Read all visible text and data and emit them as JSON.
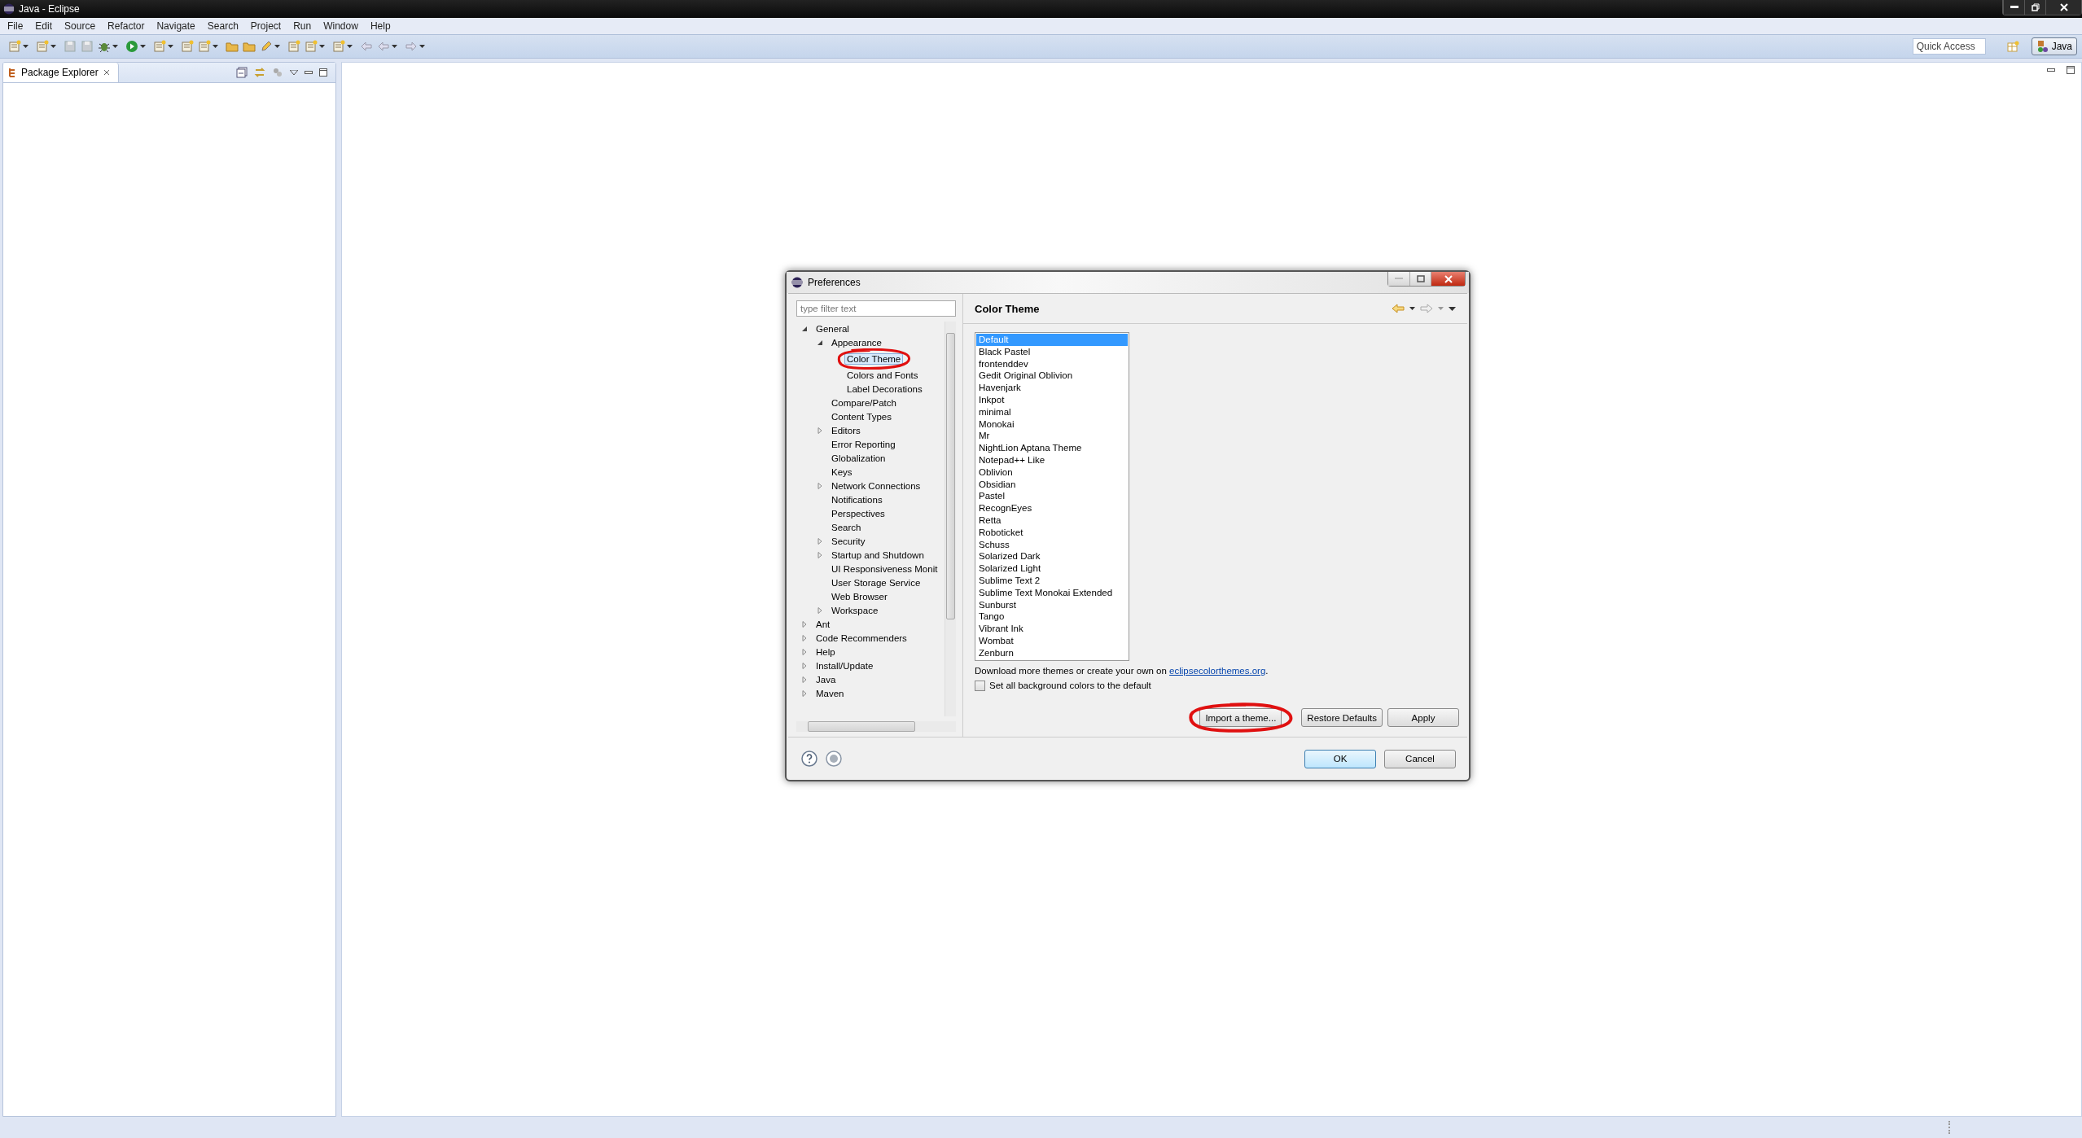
{
  "window": {
    "title": "Java - Eclipse"
  },
  "menu": [
    "File",
    "Edit",
    "Source",
    "Refactor",
    "Navigate",
    "Search",
    "Project",
    "Run",
    "Window",
    "Help"
  ],
  "toolbar": {
    "quick_access": {
      "placeholder": "Quick Access"
    },
    "perspectives": [
      {
        "label": "Java",
        "selected": true
      }
    ]
  },
  "package_explorer": {
    "tab": {
      "label": "Package Explorer",
      "selected": true
    }
  },
  "dialog": {
    "title": "Preferences",
    "filter": {
      "placeholder": "type filter text"
    },
    "tree": [
      {
        "label": "General",
        "expanded": true,
        "selected": false,
        "children": [
          {
            "label": "Appearance",
            "expanded": true,
            "selected": false,
            "children": [
              {
                "label": "Color Theme",
                "selected": true
              },
              {
                "label": "Colors and Fonts",
                "selected": false
              },
              {
                "label": "Label Decorations",
                "selected": false
              }
            ]
          },
          {
            "label": "Compare/Patch",
            "selected": false
          },
          {
            "label": "Content Types",
            "selected": false
          },
          {
            "label": "Editors",
            "expanded": false,
            "selected": false
          },
          {
            "label": "Error Reporting",
            "selected": false
          },
          {
            "label": "Globalization",
            "selected": false
          },
          {
            "label": "Keys",
            "selected": false
          },
          {
            "label": "Network Connections",
            "expanded": false,
            "selected": false
          },
          {
            "label": "Notifications",
            "selected": false
          },
          {
            "label": "Perspectives",
            "selected": false
          },
          {
            "label": "Search",
            "selected": false
          },
          {
            "label": "Security",
            "expanded": false,
            "selected": false
          },
          {
            "label": "Startup and Shutdown",
            "expanded": false,
            "selected": false
          },
          {
            "label": "UI Responsiveness Monit",
            "selected": false
          },
          {
            "label": "User Storage Service",
            "selected": false
          },
          {
            "label": "Web Browser",
            "selected": false
          },
          {
            "label": "Workspace",
            "expanded": false,
            "selected": false
          }
        ]
      },
      {
        "label": "Ant",
        "expanded": false,
        "selected": false
      },
      {
        "label": "Code Recommenders",
        "expanded": false,
        "selected": false
      },
      {
        "label": "Help",
        "expanded": false,
        "selected": false
      },
      {
        "label": "Install/Update",
        "expanded": false,
        "selected": false
      },
      {
        "label": "Java",
        "expanded": false,
        "selected": false
      },
      {
        "label": "Maven",
        "expanded": false,
        "selected": false
      }
    ],
    "page_title": "Color Theme",
    "themes": [
      {
        "label": "Default",
        "selected": true
      },
      {
        "label": "Black Pastel",
        "selected": false
      },
      {
        "label": "frontenddev",
        "selected": false
      },
      {
        "label": "Gedit Original Oblivion",
        "selected": false
      },
      {
        "label": "Havenjark",
        "selected": false
      },
      {
        "label": "Inkpot",
        "selected": false
      },
      {
        "label": "minimal",
        "selected": false
      },
      {
        "label": "Monokai",
        "selected": false
      },
      {
        "label": "Mr",
        "selected": false
      },
      {
        "label": "NightLion Aptana Theme",
        "selected": false
      },
      {
        "label": "Notepad++ Like",
        "selected": false
      },
      {
        "label": "Oblivion",
        "selected": false
      },
      {
        "label": "Obsidian",
        "selected": false
      },
      {
        "label": "Pastel",
        "selected": false
      },
      {
        "label": "RecognEyes",
        "selected": false
      },
      {
        "label": "Retta",
        "selected": false
      },
      {
        "label": "Roboticket",
        "selected": false
      },
      {
        "label": "Schuss",
        "selected": false
      },
      {
        "label": "Solarized Dark",
        "selected": false
      },
      {
        "label": "Solarized Light",
        "selected": false
      },
      {
        "label": "Sublime Text 2",
        "selected": false
      },
      {
        "label": "Sublime Text Monokai Extended",
        "selected": false
      },
      {
        "label": "Sunburst",
        "selected": false
      },
      {
        "label": "Tango",
        "selected": false
      },
      {
        "label": "Vibrant Ink",
        "selected": false
      },
      {
        "label": "Wombat",
        "selected": false
      },
      {
        "label": "Zenburn",
        "selected": false
      }
    ],
    "download_note": {
      "text": "Download more themes or create your own on ",
      "link": "eclipsecolorthemes.org",
      "after": "."
    },
    "checkbox": {
      "label": "Set all background colors to the default",
      "checked": false
    },
    "page_buttons": [
      "Import a theme...",
      "Restore Defaults",
      "Apply"
    ],
    "dialog_buttons": [
      {
        "label": "OK",
        "default": true
      },
      {
        "label": "Cancel",
        "default": false
      }
    ]
  }
}
